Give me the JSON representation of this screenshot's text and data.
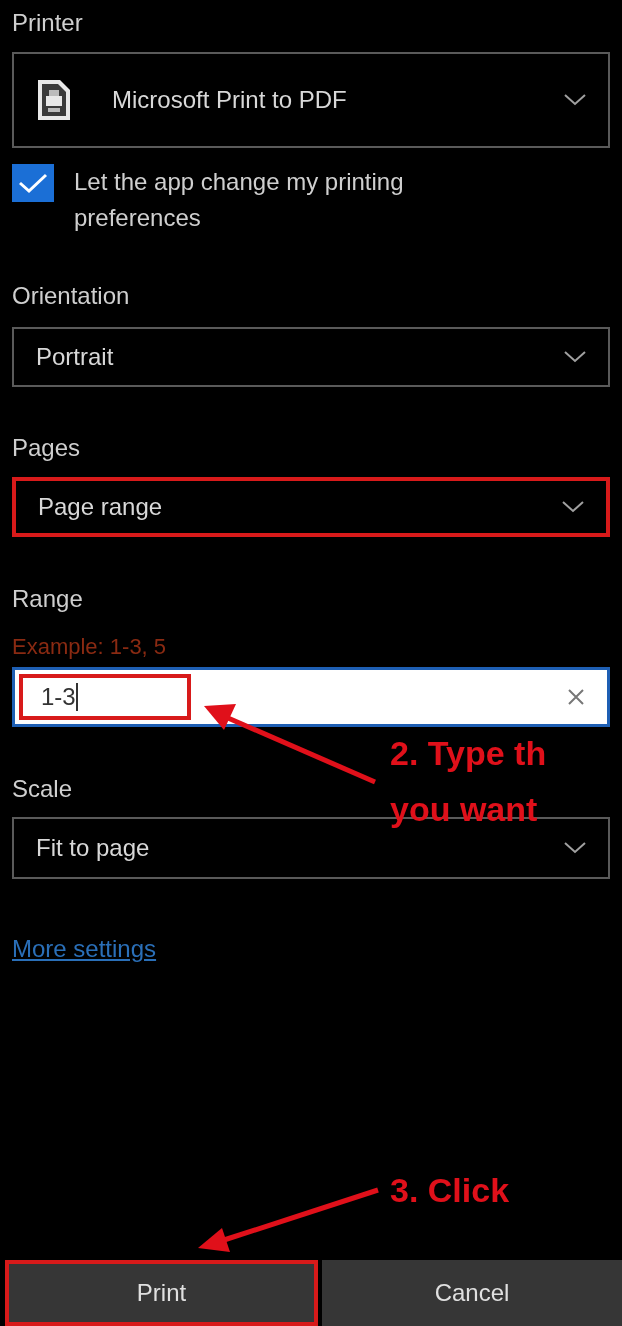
{
  "printer": {
    "label": "Printer",
    "value": "Microsoft Print to PDF",
    "highlighted": false
  },
  "app_preferences": {
    "label": "Let the app change my printing preferences",
    "checked": true
  },
  "orientation": {
    "label": "Orientation",
    "value": "Portrait",
    "highlighted": false
  },
  "pages": {
    "label": "Pages",
    "value": "Page range",
    "highlighted": true
  },
  "range": {
    "label": "Range",
    "hint": "Example: 1-3, 5",
    "value": "1-3",
    "highlighted": true
  },
  "scale": {
    "label": "Scale",
    "value": "Fit to page",
    "highlighted": false
  },
  "more_settings": "More settings",
  "buttons": [
    {
      "label": "Print",
      "highlighted": true
    },
    {
      "label": "Cancel",
      "highlighted": false
    }
  ],
  "annotations": [
    {
      "lines": [
        "2. Type th",
        "you want"
      ]
    },
    {
      "lines": [
        "3. Click"
      ]
    }
  ]
}
